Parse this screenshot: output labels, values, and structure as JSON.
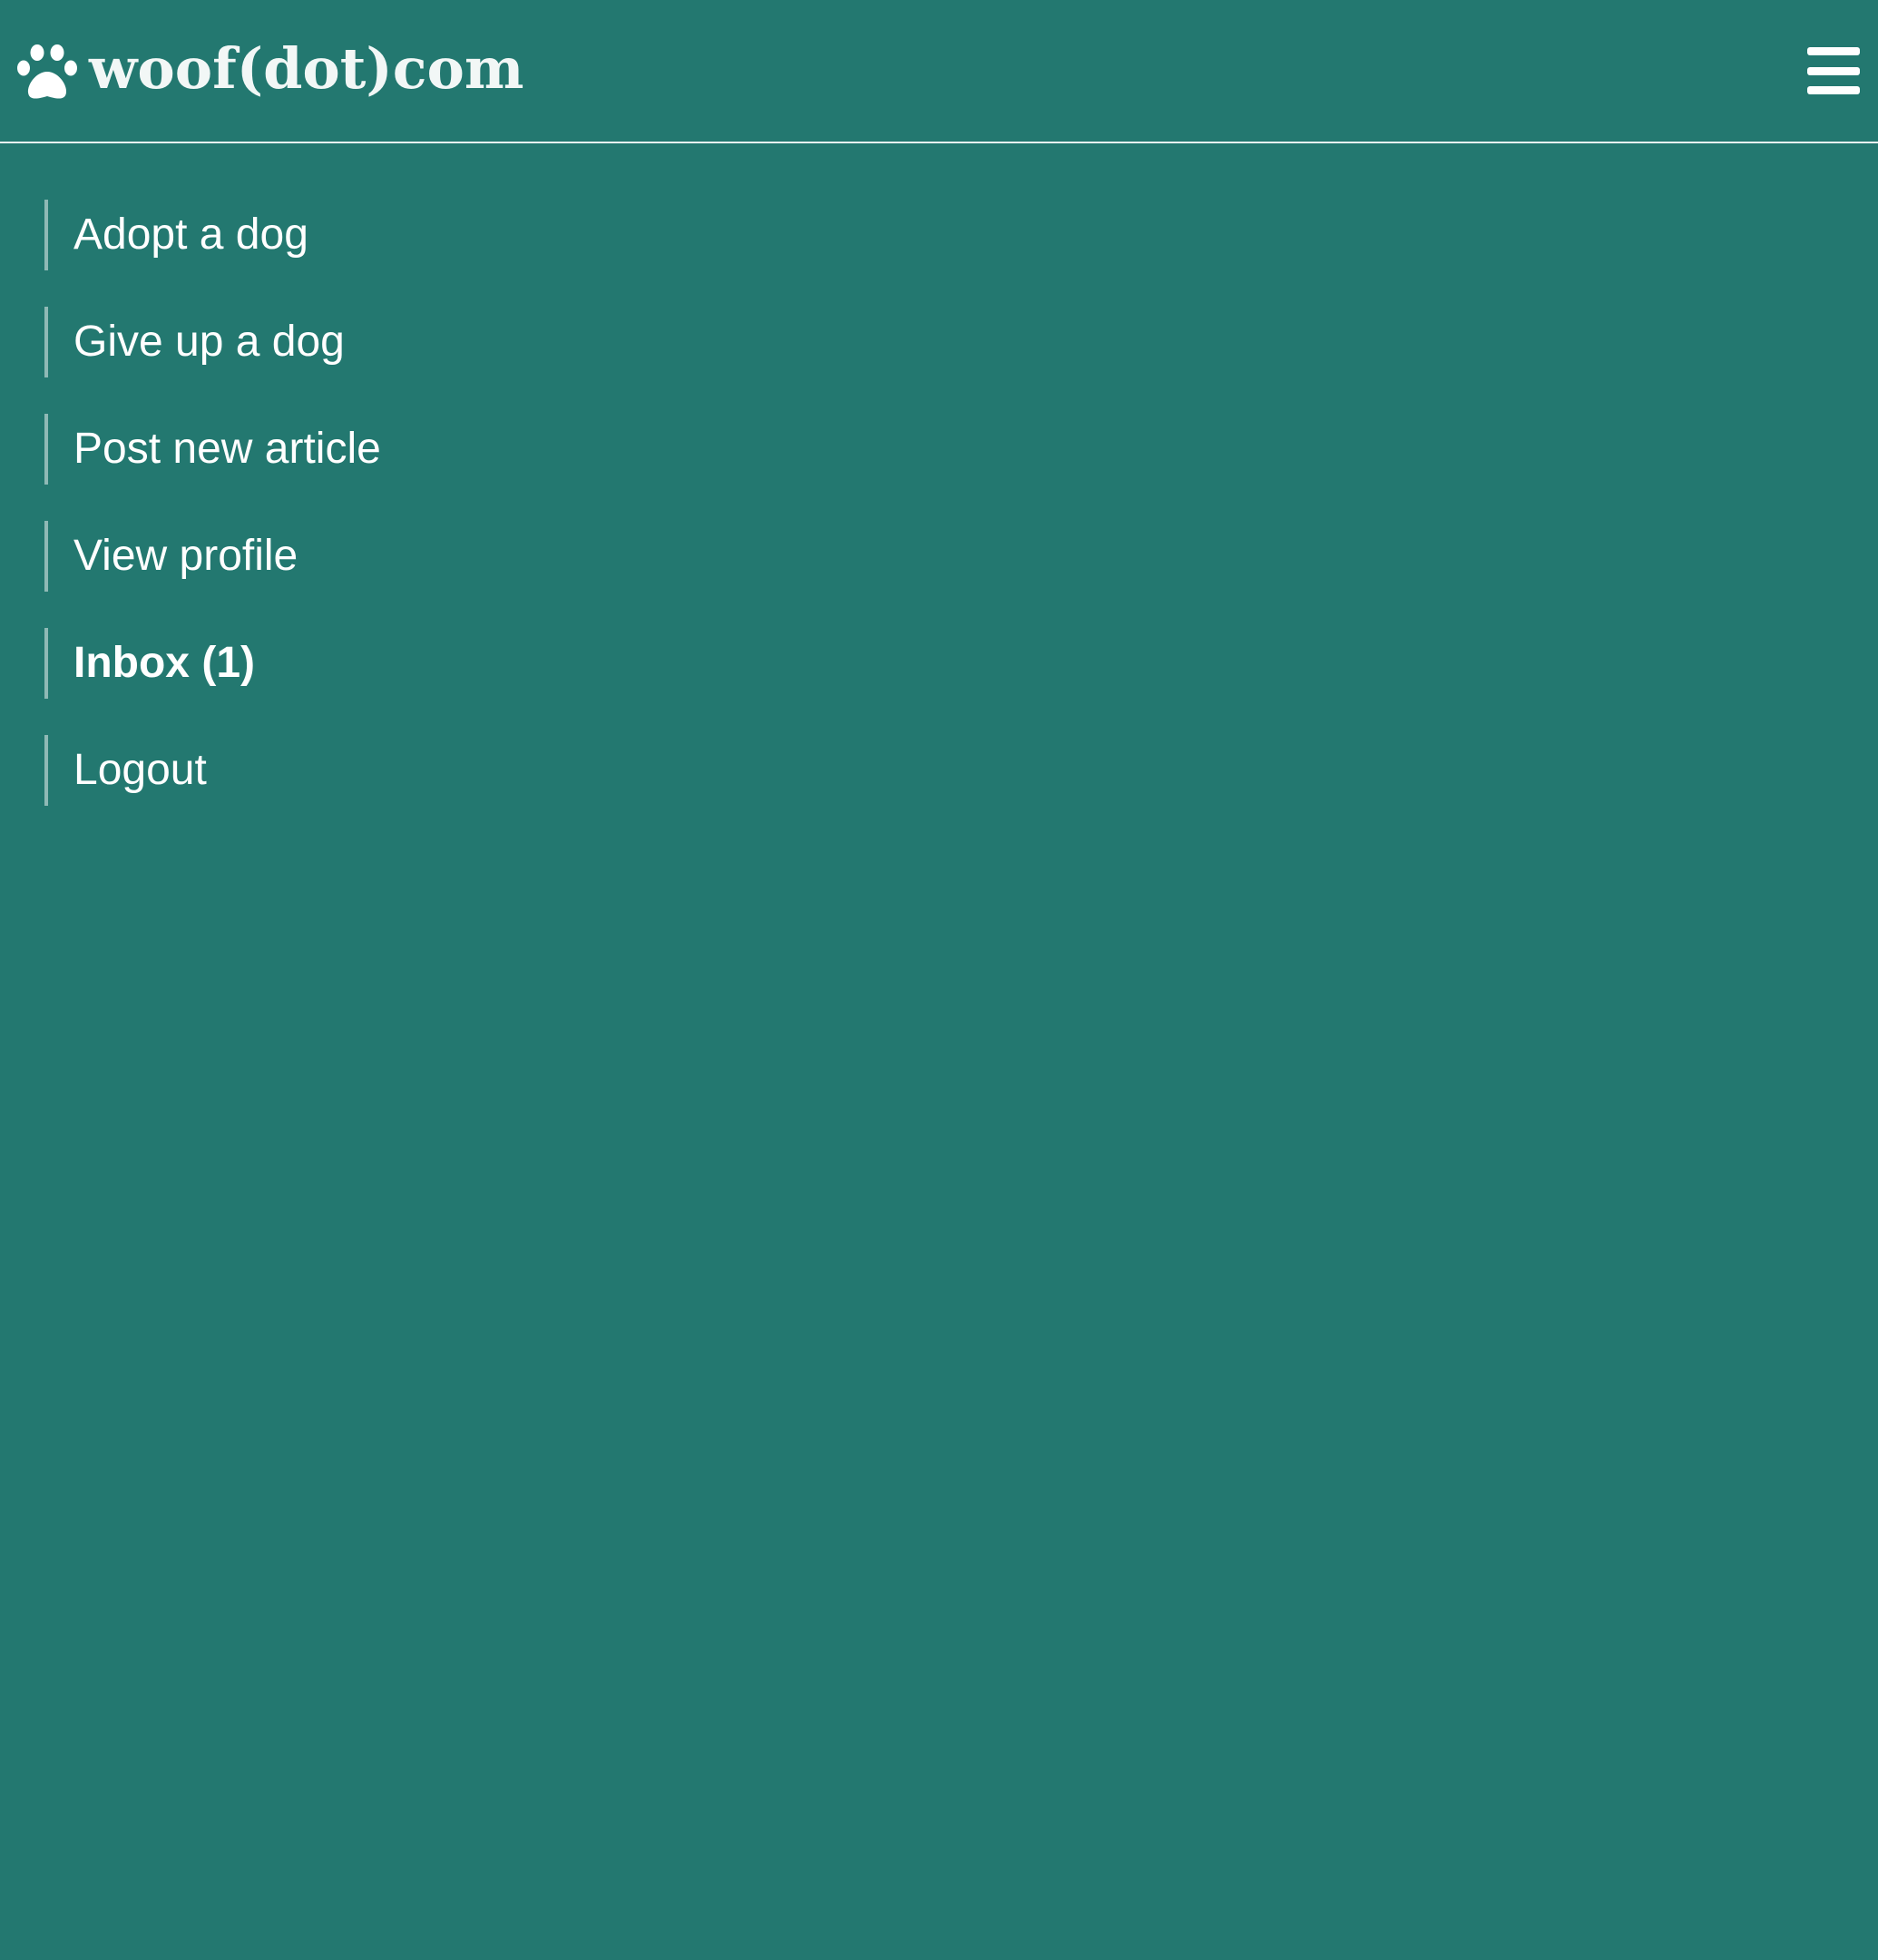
{
  "header": {
    "logo_text": "woof(dot)com",
    "menu_icon": "hamburger-menu-icon"
  },
  "nav": {
    "items": [
      {
        "label": "Adopt a dog"
      },
      {
        "label": "Give up a dog"
      },
      {
        "label": "Post new article"
      },
      {
        "label": "View profile"
      },
      {
        "label": "Inbox (1)"
      },
      {
        "label": "Logout"
      }
    ]
  },
  "colors": {
    "background": "#237870",
    "text": "#ffffff",
    "nav_rule": "#8fb9b5",
    "header_border": "#e9f1f0"
  }
}
